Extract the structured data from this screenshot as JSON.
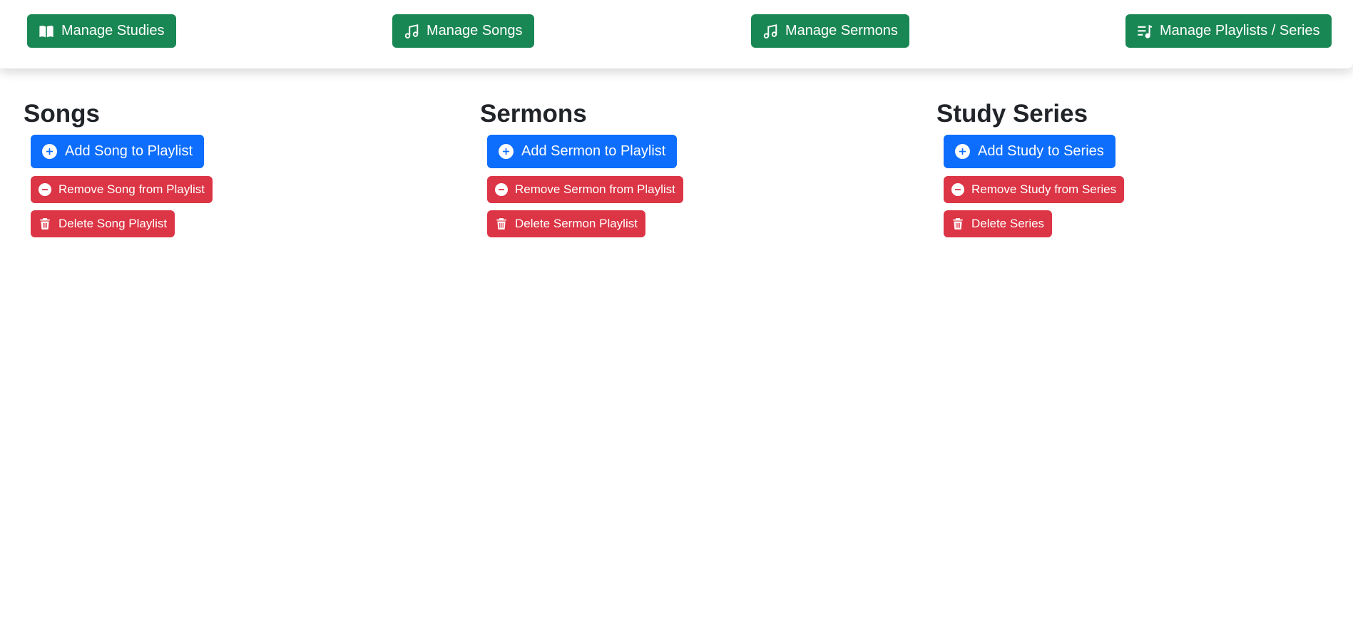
{
  "colors": {
    "nav_button": "#198754",
    "add_button": "#0d6efd",
    "danger_button": "#dc3545",
    "heading": "#212529"
  },
  "nav": {
    "manage_studies": {
      "label": "Manage Studies",
      "icon": "book-icon"
    },
    "manage_songs": {
      "label": "Manage Songs",
      "icon": "music-note-icon"
    },
    "manage_sermons": {
      "label": "Manage Sermons",
      "icon": "music-note-icon"
    },
    "manage_playlists": {
      "label": "Manage Playlists / Series",
      "icon": "playlist-icon"
    }
  },
  "songs": {
    "title": "Songs",
    "add_label": "Add Song to Playlist",
    "remove_label": "Remove Song from Playlist",
    "delete_label": "Delete Song Playlist"
  },
  "sermons": {
    "title": "Sermons",
    "add_label": "Add Sermon to Playlist",
    "remove_label": "Remove Sermon from Playlist",
    "delete_label": "Delete Sermon Playlist"
  },
  "study_series": {
    "title": "Study Series",
    "add_label": "Add Study to Series",
    "remove_label": "Remove Study from Series",
    "delete_label": "Delete Series"
  }
}
